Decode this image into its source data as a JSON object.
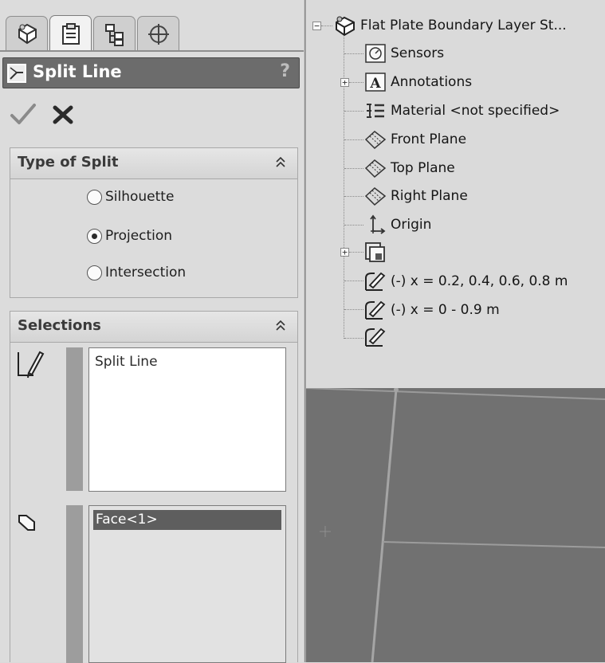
{
  "tabs": [
    {
      "name": "feature-manager",
      "icon": "feature-manager-icon",
      "active": false
    },
    {
      "name": "property-manager",
      "icon": "property-manager-icon",
      "active": true
    },
    {
      "name": "configuration-manager",
      "icon": "configuration-manager-icon",
      "active": false
    },
    {
      "name": "dimxpert-manager",
      "icon": "crosshair-icon",
      "active": false
    }
  ],
  "panel": {
    "title": "Split Line",
    "help": "?"
  },
  "type_group": {
    "title": "Type of Split",
    "options": [
      "Silhouette",
      "Projection",
      "Intersection"
    ],
    "selected": "Projection"
  },
  "selections_group": {
    "title": "Selections",
    "sketch_box": {
      "items": [
        "Split Line"
      ]
    },
    "face_box": {
      "items": [
        "Face<1>"
      ]
    }
  },
  "tree": {
    "root": "Flat Plate Boundary Layer St...",
    "items": [
      {
        "label": "Sensors",
        "icon": "sensors-icon"
      },
      {
        "label": "Annotations",
        "icon": "annotations-icon"
      },
      {
        "label": "Material <not specified>",
        "icon": "material-icon"
      },
      {
        "label": "Front Plane",
        "icon": "plane-icon"
      },
      {
        "label": "Top Plane",
        "icon": "plane-icon"
      },
      {
        "label": "Right Plane",
        "icon": "plane-icon"
      },
      {
        "label": "Origin",
        "icon": "origin-icon"
      },
      {
        "label": "",
        "icon": "extrude-icon"
      },
      {
        "label": "(-) x = 0.2, 0.4, 0.6, 0.8 m",
        "icon": "sketch-icon"
      },
      {
        "label": "(-) x = 0 - 0.9 m",
        "icon": "sketch-icon"
      },
      {
        "label": "",
        "icon": "sketch-icon"
      }
    ]
  },
  "colors": {
    "title_bar": "#6c6c6c",
    "graphics_bg": "#717171",
    "panel_bg": "#dcdcdc",
    "selected_item": "#5e5e5e"
  }
}
